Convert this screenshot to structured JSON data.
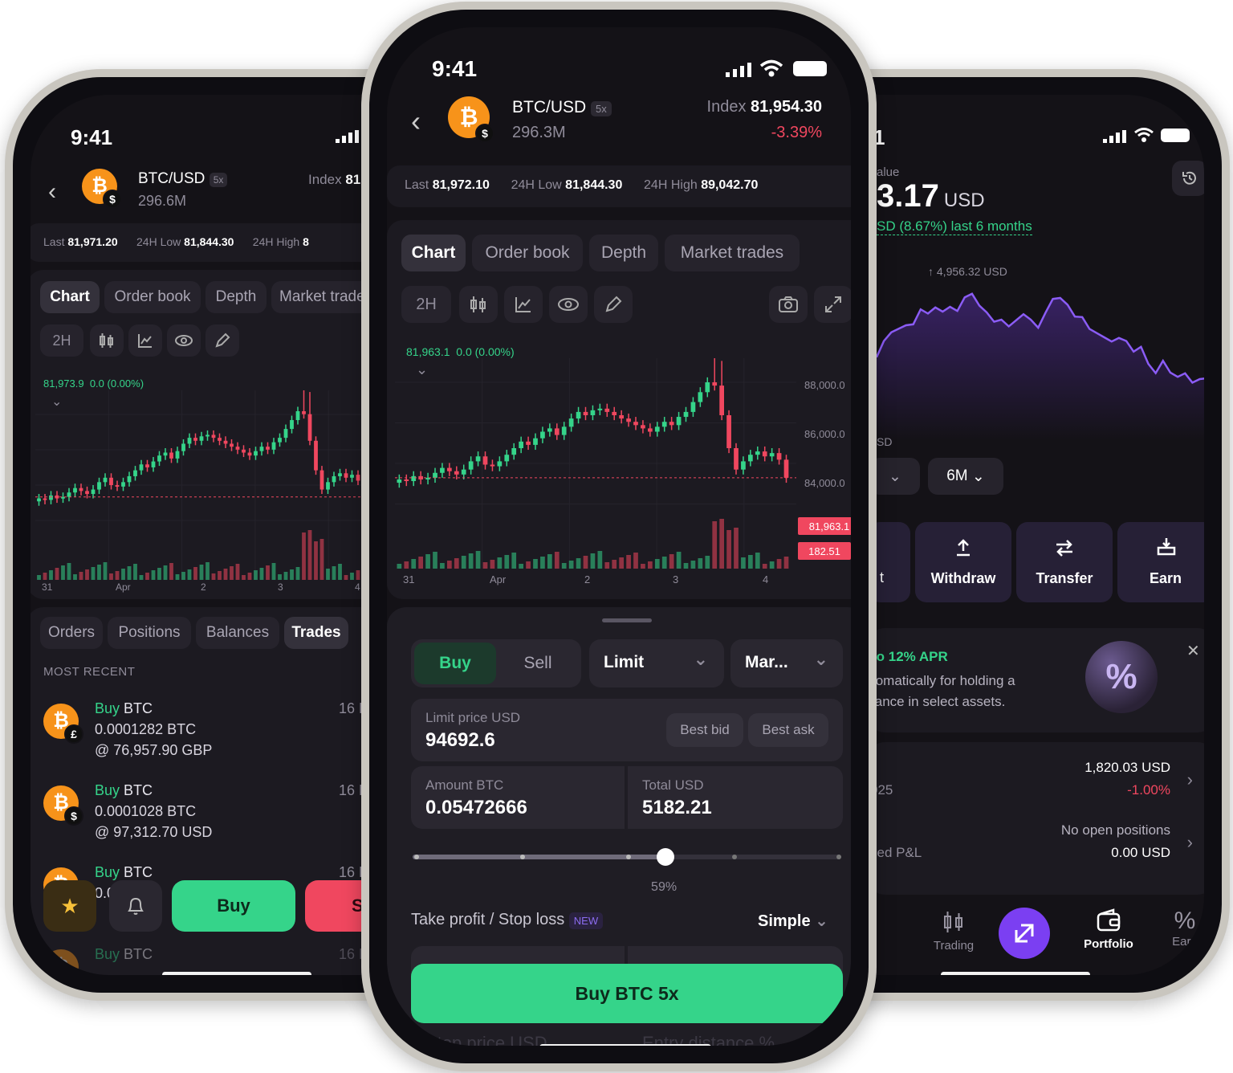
{
  "status": {
    "time": "9:41"
  },
  "colors": {
    "up": "#35d48a",
    "down": "#f0475f",
    "accent": "#7b3ff2",
    "bg": "#141217"
  },
  "center": {
    "pair": "BTC/USD",
    "leverage": "5x",
    "volume": "296.3M",
    "index_label": "Index",
    "index_value": "81,954.30",
    "change": "-3.39%",
    "stats": {
      "last_label": "Last",
      "last": "81,972.10",
      "low_label": "24H Low",
      "low": "81,844.30",
      "high_label": "24H High",
      "high": "89,042.70"
    },
    "tabs": [
      "Chart",
      "Order book",
      "Depth",
      "Market trades"
    ],
    "interval": "2H",
    "chart_readout": "81,963.1  0.0 (0.00%)",
    "price_tag": "81,963.1",
    "volume_tag": "182.51",
    "y_ticks": [
      "88,000.0",
      "86,000.0",
      "84,000.0"
    ],
    "x_ticks": [
      "31",
      "Apr",
      "2",
      "3",
      "4"
    ],
    "order": {
      "buy": "Buy",
      "sell": "Sell",
      "type": "Limit",
      "tif": "Mar...",
      "limit_label": "Limit price USD",
      "limit_value": "94692.6",
      "best_bid": "Best bid",
      "best_ask": "Best ask",
      "amount_label": "Amount BTC",
      "amount_value": "0.05472666",
      "total_label": "Total USD",
      "total_value": "5182.21",
      "slider_pct": "59%",
      "tpsl_label": "Take profit / Stop loss",
      "tpsl_badge": "NEW",
      "tpsl_mode": "Simple",
      "submit": "Buy BTC 5x",
      "stop_label": "Stop price USD",
      "entry_label": "Entry distance %"
    }
  },
  "left": {
    "pair": "BTC/USD",
    "leverage": "5x",
    "volume": "296.6M",
    "index_label": "Index",
    "index_value": "81",
    "stats": {
      "last_label": "Last",
      "last": "81,971.20",
      "low_label": "24H Low",
      "low": "81,844.30",
      "high_label": "24H High",
      "high": "8"
    },
    "tabs": [
      "Chart",
      "Order book",
      "Depth",
      "Market trade"
    ],
    "interval": "2H",
    "chart_readout": "81,973.9  0.0 (0.00%)",
    "x_ticks": [
      "31",
      "Apr",
      "2",
      "3",
      "4"
    ],
    "bottom_tabs": [
      "Orders",
      "Positions",
      "Balances",
      "Trades"
    ],
    "section": "MOST RECENT",
    "trades": [
      {
        "title_action": "Buy",
        "title_asset": "BTC",
        "amount": "0.0001282 BTC",
        "price": "@ 76,957.90 GBP",
        "date": "16 F",
        "fiat": "£"
      },
      {
        "title_action": "Buy",
        "title_asset": "BTC",
        "amount": "0.0001028 BTC",
        "price": "@ 97,312.70 USD",
        "date": "16 F",
        "fiat": "$"
      },
      {
        "title_action": "Buy",
        "title_asset": "BTC",
        "amount": "0.0",
        "price": "@",
        "date": "16 F",
        "fiat": "$"
      },
      {
        "title_action": "Buy",
        "title_asset": "BTC",
        "amount": "",
        "price": "",
        "date": "16 F",
        "fiat": "$"
      }
    ],
    "buy": "Buy",
    "sell": "Se"
  },
  "right": {
    "value_label": "alue",
    "value": "3.17",
    "value_unit": "USD",
    "gain": "SD (8.67%) last 6 months",
    "peak": "↑ 4,956.32 USD",
    "low": "SD",
    "range": "6M",
    "actions": [
      "Withdraw",
      "Transfer",
      "Earn"
    ],
    "promo_title": "to 12% APR",
    "promo_line1": "tomatically for holding a",
    "promo_line2": "lance in select assets.",
    "row1_value": "1,820.03 USD",
    "row1_change": "-1.00%",
    "row1_label": "025",
    "row2_value": "No open positions",
    "row2_sub": "0.00 USD",
    "row2_label": "zed P&L",
    "nav": [
      "Trading",
      "Portfolio",
      "Earn"
    ]
  }
}
